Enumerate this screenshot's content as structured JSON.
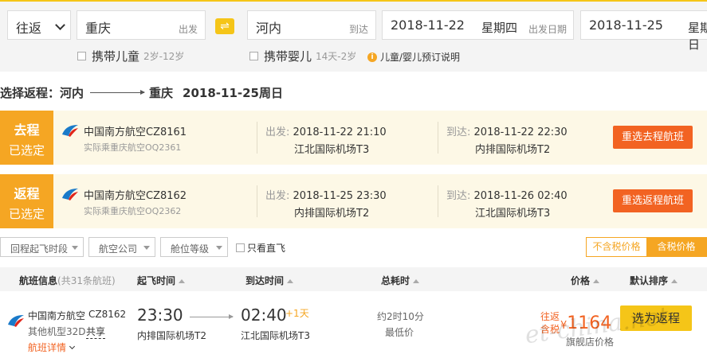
{
  "search": {
    "trip_type": "往返",
    "from_city": "重庆",
    "from_hint": "出发",
    "swap_icon": "⇌",
    "to_city": "河内",
    "to_hint": "到达",
    "depart_date": "2018-11-22",
    "depart_week": "星期四",
    "depart_hint": "出发日期",
    "return_date": "2018-11-25",
    "return_week": "星期日",
    "options": {
      "child_label": "携带儿童",
      "child_sub": "2岁-12岁",
      "infant_label": "携带婴儿",
      "infant_sub": "14天-2岁",
      "note": "儿童/婴儿预订说明",
      "note_icon": "i"
    }
  },
  "route_title": {
    "prefix": "选择返程：",
    "from": "河内",
    "to": "重庆",
    "date": "2018-11-25周日"
  },
  "legs": [
    {
      "tag": "去程",
      "status": "已选定",
      "airline": "中国南方航空CZ8161",
      "operated": "实际乘重庆航空OQ2361",
      "dep_label": "出发:",
      "dep_time": "2018-11-22 21:10",
      "dep_airport": "江北国际机场T3",
      "arr_label": "到达:",
      "arr_time": "2018-11-22 22:30",
      "arr_airport": "内排国际机场T2",
      "button": "重选去程航班"
    },
    {
      "tag": "返程",
      "status": "已选定",
      "airline": "中国南方航空CZ8162",
      "operated": "实际乘重庆航空OQ2362",
      "dep_label": "出发:",
      "dep_time": "2018-11-25 23:30",
      "dep_airport": "内排国际机场T2",
      "arr_label": "到达:",
      "arr_time": "2018-11-26 02:40",
      "arr_airport": "江北国际机场T3",
      "button": "重选返程航班"
    }
  ],
  "filters": {
    "dep_period": "回程起飞时段",
    "airline": "航空公司",
    "cabin": "舱位等级",
    "direct_only": "只看直飞",
    "tax_excluded": "不含税价格",
    "tax_included": "含税价格"
  },
  "table_header": {
    "info": "航班信息",
    "info_count": "(共31条航班)",
    "dep": "起飞时间",
    "arr": "到达时间",
    "duration": "总耗时",
    "price": "价格",
    "sort": "默认排序"
  },
  "flight": {
    "airline": "中国南方航空",
    "flight_no": "CZ8162",
    "model": "其他机型32D",
    "shared": "共享",
    "detail": "航班详情",
    "dep_time": "23:30",
    "dep_airport": "内排国际机场T2",
    "arr_time": "02:40",
    "arr_plus": "+1天",
    "arr_airport": "江北国际机场T3",
    "duration": "约2时10分",
    "lowest": "最低价",
    "price_label1": "往返",
    "price_label2": "含税",
    "currency": "¥",
    "price": "1164",
    "store": "旗舰店价格",
    "button": "选为返程"
  },
  "watermark": "et-china.net",
  "colors": {
    "accent_yellow": "#f5c518",
    "tag_orange": "#f5a623",
    "button_orange": "#f26322",
    "leg_bg": "#fdf8e6"
  }
}
